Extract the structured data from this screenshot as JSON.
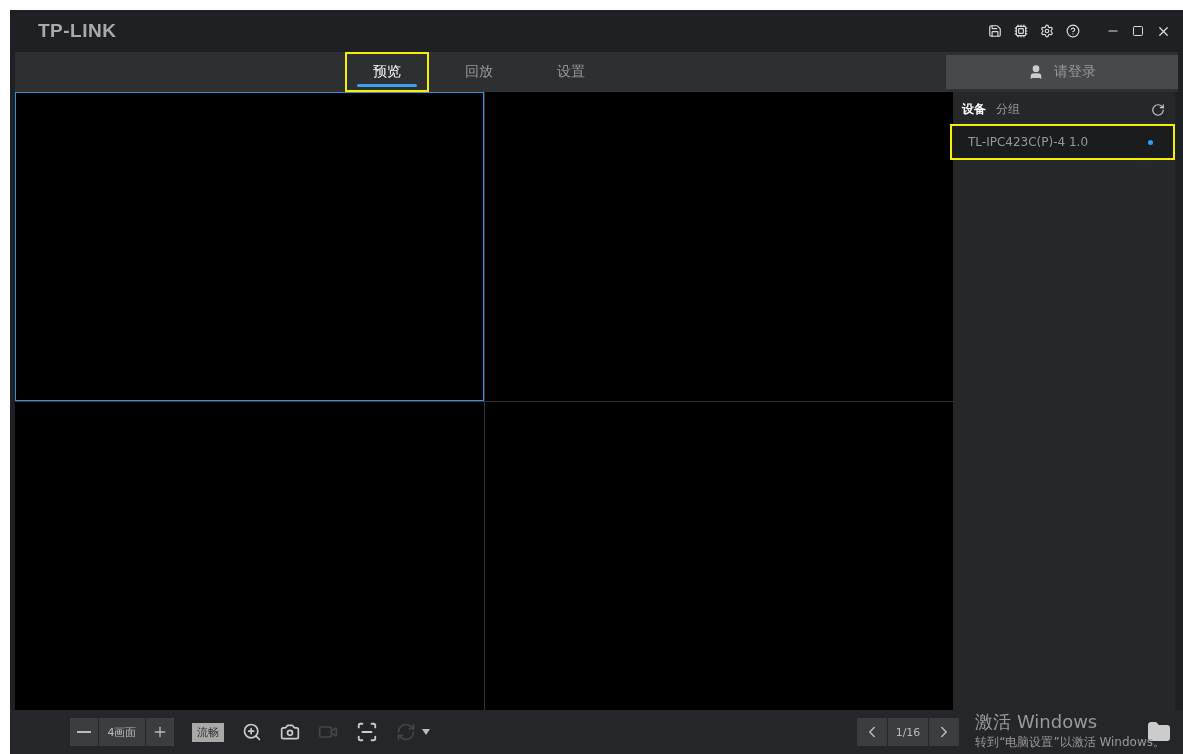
{
  "window": {
    "logo": "TP-LINK"
  },
  "tabs": [
    {
      "label": "预览",
      "selected": true,
      "highlighted": true
    },
    {
      "label": "回放",
      "selected": false,
      "highlighted": false
    },
    {
      "label": "设置",
      "selected": false,
      "highlighted": false
    }
  ],
  "login": {
    "label": "请登录"
  },
  "video_grid": {
    "cells": [
      {
        "selected": true
      },
      {
        "selected": false
      },
      {
        "selected": false
      },
      {
        "selected": false
      }
    ]
  },
  "sidebar": {
    "tabs": [
      {
        "label": "设备",
        "selected": true
      },
      {
        "label": "分组",
        "selected": false
      }
    ],
    "devices": [
      {
        "name": "TL-IPC423C(P)-4 1.0",
        "online": true,
        "highlighted": true
      }
    ]
  },
  "toolbar": {
    "layout": "4画面",
    "stream": "流畅",
    "page": "1/16"
  },
  "activation": {
    "title": "激活 Windows",
    "hint": "转到“电脑设置”以激活 Windows。"
  }
}
